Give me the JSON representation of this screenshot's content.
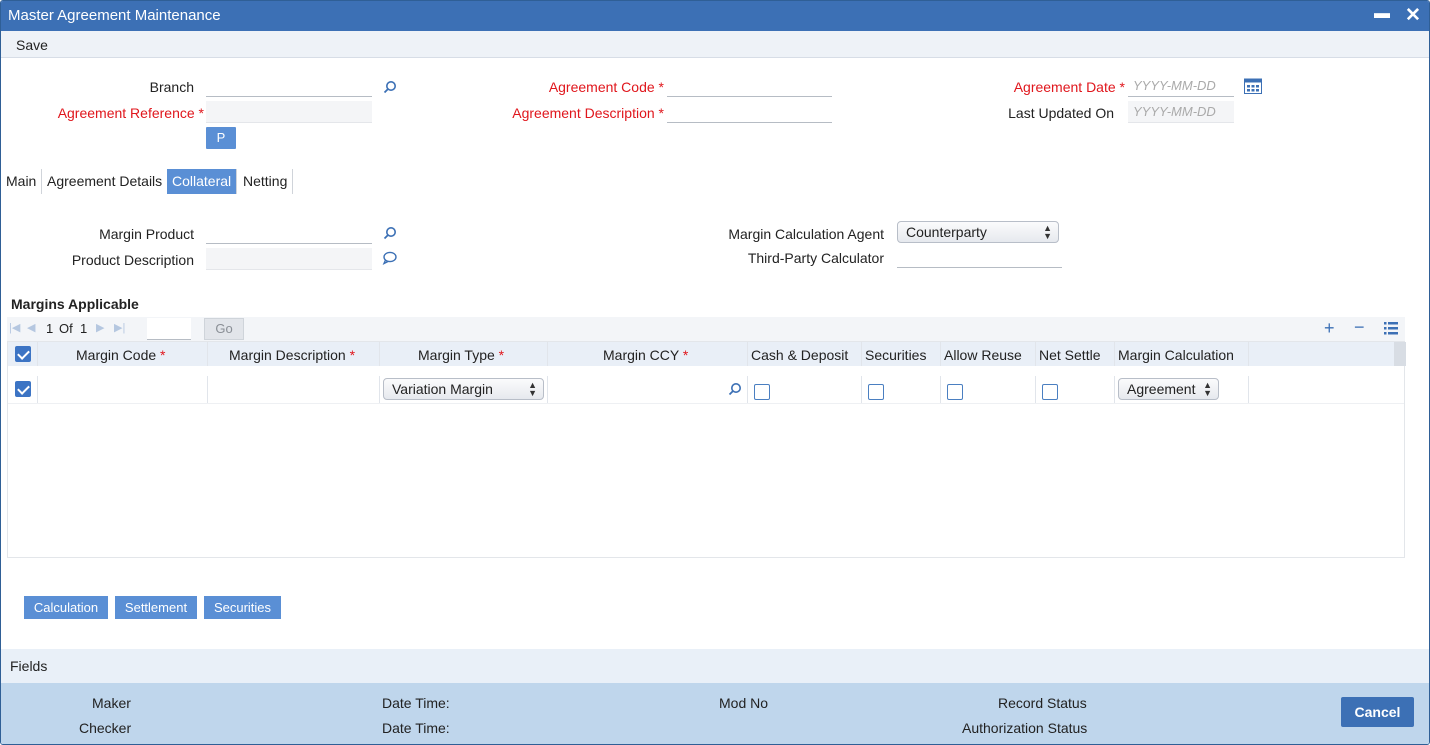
{
  "window": {
    "title": "Master Agreement Maintenance"
  },
  "menu": {
    "save": "Save"
  },
  "header": {
    "branch_label": "Branch",
    "agreement_ref_label": "Agreement Reference",
    "agreement_code_label": "Agreement Code",
    "agreement_desc_label": "Agreement Description",
    "agreement_date_label": "Agreement Date",
    "agreement_date_placeholder": "YYYY-MM-DD",
    "last_updated_label": "Last Updated On",
    "last_updated_placeholder": "YYYY-MM-DD",
    "p_button": "P",
    "required_mark": "*"
  },
  "tabs": [
    {
      "label": "Main"
    },
    {
      "label": "Agreement Details"
    },
    {
      "label": "Collateral",
      "active": true
    },
    {
      "label": "Netting"
    }
  ],
  "collateral": {
    "margin_product_label": "Margin Product",
    "product_desc_label": "Product Description",
    "calc_agent_label": "Margin Calculation Agent",
    "calc_agent_value": "Counterparty",
    "third_party_label": "Third-Party Calculator"
  },
  "margins": {
    "title": "Margins Applicable",
    "pager": {
      "current": "1",
      "of": "Of",
      "total": "1",
      "go": "Go"
    },
    "columns": [
      "Margin Code",
      "Margin Description",
      "Margin Type",
      "Margin CCY",
      "Cash & Deposit",
      "Securities",
      "Allow Reuse",
      "Net Settle",
      "Margin Calculation"
    ],
    "row": {
      "margin_type": "Variation Margin",
      "margin_calculation": "Agreement"
    }
  },
  "buttons": {
    "calculation": "Calculation",
    "settlement": "Settlement",
    "securities": "Securities"
  },
  "fields_bar": {
    "label": "Fields"
  },
  "footer": {
    "maker": "Maker",
    "checker": "Checker",
    "date_time_1": "Date Time:",
    "date_time_2": "Date Time:",
    "mod_no": "Mod No",
    "record_status": "Record Status",
    "auth_status": "Authorization Status",
    "cancel": "Cancel"
  },
  "colors": {
    "title_bar": "#3c70b5",
    "accent": "#5a8fd5",
    "required": "#e0161c",
    "footer": "#bfd6ec"
  }
}
